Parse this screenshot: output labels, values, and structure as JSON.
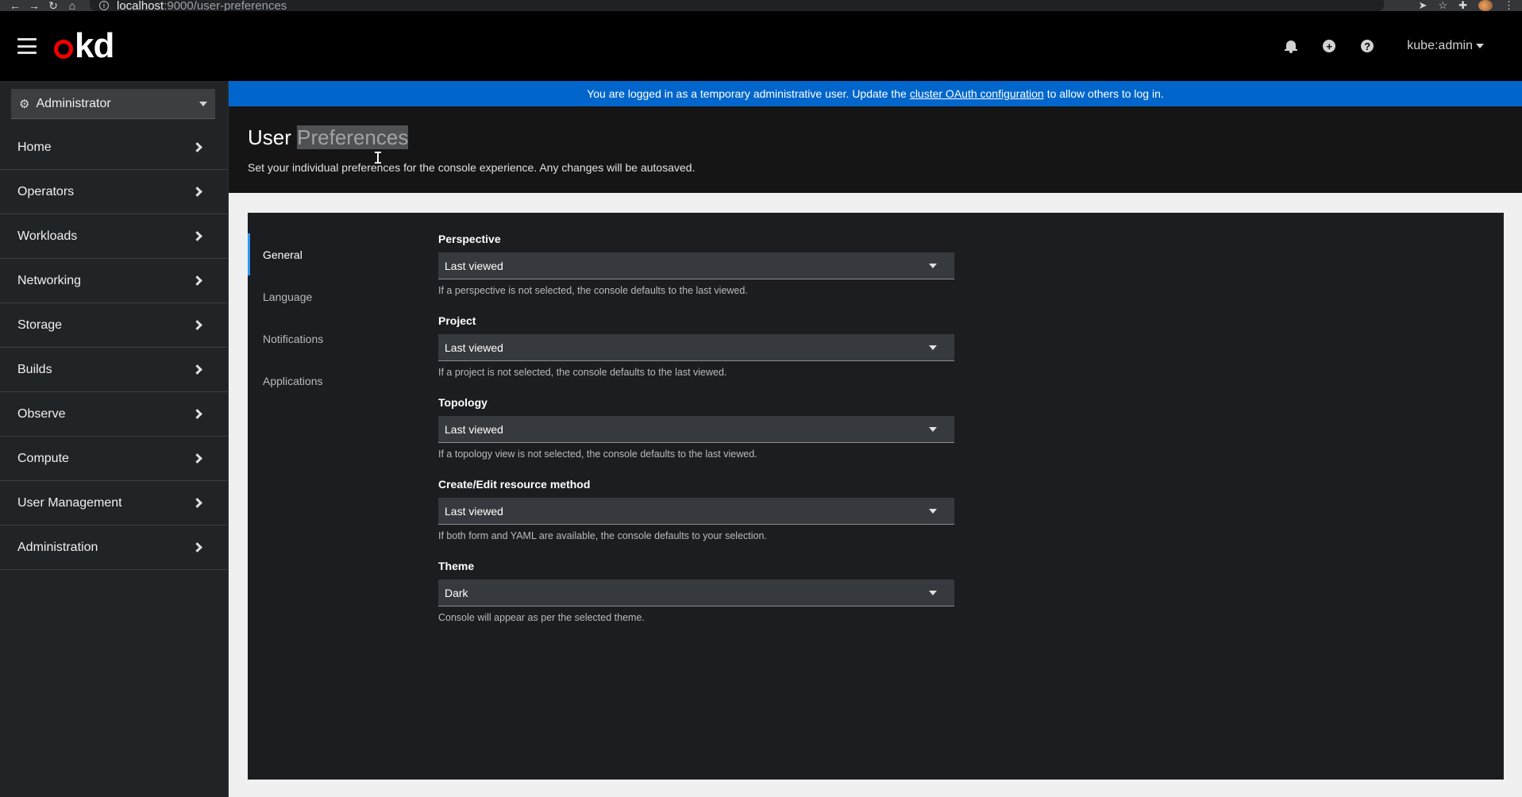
{
  "browser": {
    "url_host": "localhost",
    "url_path": ":9000/user-preferences"
  },
  "masthead": {
    "logo_text": "kd",
    "user": "kube:admin"
  },
  "sidebar": {
    "perspective": "Administrator",
    "items": [
      {
        "label": "Home"
      },
      {
        "label": "Operators"
      },
      {
        "label": "Workloads"
      },
      {
        "label": "Networking"
      },
      {
        "label": "Storage"
      },
      {
        "label": "Builds"
      },
      {
        "label": "Observe"
      },
      {
        "label": "Compute"
      },
      {
        "label": "User Management"
      },
      {
        "label": "Administration"
      }
    ]
  },
  "banner": {
    "text_before": "You are logged in as a temporary administrative user. Update the",
    "link": "cluster OAuth configuration",
    "text_after": "to allow others to log in."
  },
  "page": {
    "title_first": "User",
    "title_second": "Preferences",
    "subtitle": "Set your individual preferences for the console experience. Any changes will be autosaved."
  },
  "tabs": [
    {
      "label": "General"
    },
    {
      "label": "Language"
    },
    {
      "label": "Notifications"
    },
    {
      "label": "Applications"
    }
  ],
  "fields": [
    {
      "label": "Perspective",
      "value": "Last viewed",
      "helper": "If a perspective is not selected, the console defaults to the last viewed."
    },
    {
      "label": "Project",
      "value": "Last viewed",
      "helper": "If a project is not selected, the console defaults to the last viewed."
    },
    {
      "label": "Topology",
      "value": "Last viewed",
      "helper": "If a topology view is not selected, the console defaults to the last viewed."
    },
    {
      "label": "Create/Edit resource method",
      "value": "Last viewed",
      "helper": "If both form and YAML are available, the console defaults to your selection."
    },
    {
      "label": "Theme",
      "value": "Dark",
      "helper": "Console will appear as per the selected theme."
    }
  ],
  "colors": {
    "banner": "#0066cc",
    "active_tab_accent": "#2b9af3",
    "logo_ring": "#ee0000"
  }
}
